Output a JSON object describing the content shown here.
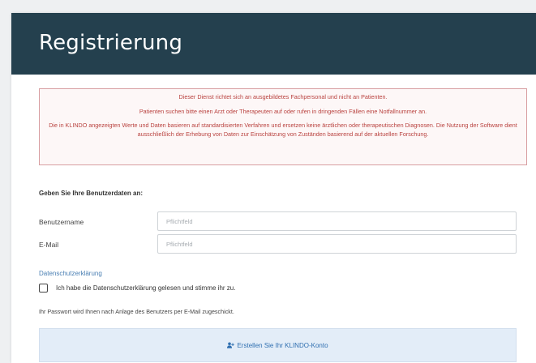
{
  "header": {
    "title": "Registrierung",
    "background_color": "#24404e"
  },
  "alert": {
    "color": "#b9423f",
    "lines": [
      "Dieser Dienst richtet sich an ausgebildetes Fachpersonal und nicht an Patienten.",
      "Patienten suchen bitte einen Arzt oder Therapeuten auf oder rufen in dringenden Fällen eine Notfallnummer an.",
      "Die in KLINDO angezeigten Werte und Daten basieren auf standardisierten Verfahren und ersetzen keine ärztlichen oder therapeutischen Diagnosen. Die Nutzung der Software dient ausschließlich der Erhebung von Daten zur Einschätzung von Zuständen basierend auf der aktuellen Forschung."
    ]
  },
  "form": {
    "section_title": "Geben Sie Ihre Benutzerdaten an:",
    "fields": [
      {
        "label": "Benutzername",
        "placeholder": "Pflichtfeld",
        "value": ""
      },
      {
        "label": "E-Mail",
        "placeholder": "Pflichtfeld",
        "value": ""
      }
    ],
    "privacy_link": "Datenschutzerklärung",
    "consent_label": "Ich habe die Datenschutzerklärung gelesen und stimme ihr zu.",
    "consent_checked": false,
    "info_text": "Ihr Passwort wird Ihnen nach Anlage des Benutzers per E-Mail zugeschickt.",
    "submit_label": "Erstellen Sie Ihr KLINDO-Konto",
    "submit_icon": "user-plus-icon"
  }
}
